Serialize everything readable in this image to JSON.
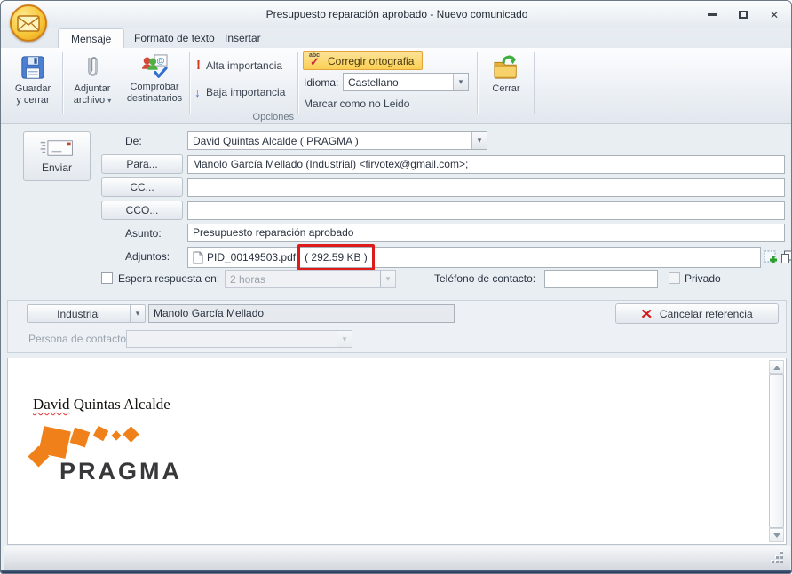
{
  "titlebar": {
    "title": "Presupuesto reparación aprobado - Nuevo comunicado"
  },
  "tabs": {
    "message": "Mensaje",
    "format": "Formato de texto",
    "insert": "Insertar"
  },
  "ribbon": {
    "save_close_label": "Guardar y cerrar",
    "attach_label": "Adjuntar archivo",
    "recipients_label": "Comprobar destinatarios",
    "high_importance_label": "Alta importancia",
    "low_importance_label": "Baja importancia",
    "options_group_label": "Opciones",
    "spellcheck_label": "Corregir ortografia",
    "language_label": "Idioma:",
    "language_value": "Castellano",
    "mark_unread_label": "Marcar como no Leido",
    "close_label": "Cerrar"
  },
  "form": {
    "send_label": "Enviar",
    "from_label": "De:",
    "from_value": "David Quintas Alcalde ( PRAGMA )",
    "to_button": "Para...",
    "to_value": "Manolo García Mellado (Industrial) <firvotex@gmail.com>;",
    "cc_button": "CC...",
    "cc_value": "",
    "bcc_button": "CCO...",
    "bcc_value": "",
    "subject_label": "Asunto:",
    "subject_value": "Presupuesto reparación aprobado",
    "attachments_label": "Adjuntos:",
    "attachment_name": "PID_00149503.pdf",
    "attachment_size": "( 292.59 KB )",
    "wait_response_label": "Espera respuesta en:",
    "wait_response_value": "2 horas",
    "phone_label": "Teléfono de contacto:",
    "phone_value": "",
    "private_label": "Privado"
  },
  "reference": {
    "type_value": "Industrial",
    "name_value": "Manolo García Mellado",
    "cancel_button": "Cancelar referencia",
    "contact_label": "Persona de contacto:",
    "contact_value": ""
  },
  "body": {
    "signature_word1": "David",
    "signature_rest": " Quintas Alcalde",
    "logo_text": "PRAGMA"
  },
  "icons": {
    "dropdown": "▾",
    "window_close": "✕",
    "high_importance": "!",
    "low_importance": "↓",
    "cancel_x": "✕",
    "spell_abc": "abc",
    "spell_check": "✓",
    "at_sign": "@"
  },
  "colors": {
    "annotation_red": "#dd1b1b",
    "brand_orange": "#f08019",
    "spell_btn_top": "#fde396",
    "spell_btn_bottom": "#fbcf54",
    "spell_btn_border": "#e2a33b"
  }
}
